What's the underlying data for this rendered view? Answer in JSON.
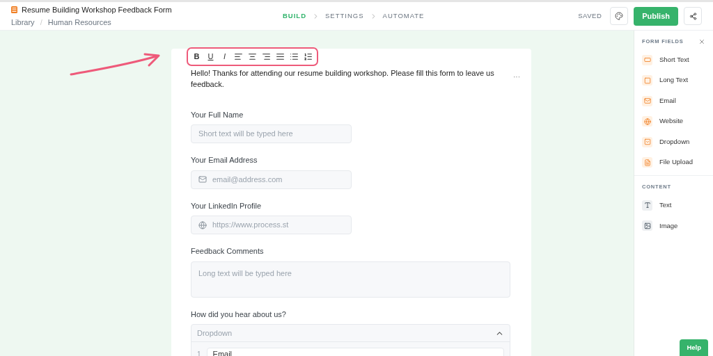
{
  "header": {
    "title": "Resume Building Workshop Feedback Form",
    "breadcrumb": [
      "Library",
      "Human Resources"
    ],
    "separator": "/",
    "steps": [
      {
        "label": "BUILD",
        "selected": true
      },
      {
        "label": "SETTINGS",
        "selected": false
      },
      {
        "label": "AUTOMATE",
        "selected": false
      }
    ],
    "status": "SAVED",
    "publish": "Publish"
  },
  "editor": {
    "toolbar": [
      {
        "kind": "bold",
        "label": "B"
      },
      {
        "kind": "underline",
        "label": "U"
      },
      {
        "kind": "italic",
        "label": "I"
      },
      {
        "kind": "align-left"
      },
      {
        "kind": "align-center"
      },
      {
        "kind": "align-right"
      },
      {
        "kind": "justify"
      },
      {
        "kind": "bullets"
      },
      {
        "kind": "numbers"
      }
    ],
    "intro": "Hello! Thanks for attending our resume building workshop. Please fill this form to leave us feedback.",
    "more": "···"
  },
  "fields": [
    {
      "kind": "short",
      "label": "Your Full Name",
      "placeholder": "Short text will be typed here"
    },
    {
      "kind": "email",
      "label": "Your Email Address",
      "placeholder": "email@address.com"
    },
    {
      "kind": "website",
      "label": "Your LinkedIn Profile",
      "placeholder": "https://www.process.st"
    },
    {
      "kind": "long",
      "label": "Feedback Comments",
      "placeholder": "Long text will be typed here"
    },
    {
      "kind": "dropdown",
      "label": "How did you hear about us?",
      "placeholder": "Dropdown",
      "expanded": true,
      "options": [
        {
          "number": "1",
          "value": "Email"
        }
      ]
    }
  ],
  "sidebar": {
    "sections": [
      {
        "title": "FORM FIELDS",
        "items": [
          {
            "kind": "short",
            "label": "Short Text"
          },
          {
            "kind": "long",
            "label": "Long Text"
          },
          {
            "kind": "email",
            "label": "Email"
          },
          {
            "kind": "website",
            "label": "Website"
          },
          {
            "kind": "dropdown",
            "label": "Dropdown"
          },
          {
            "kind": "upload",
            "label": "File Upload"
          }
        ]
      },
      {
        "title": "CONTENT",
        "items": [
          {
            "kind": "text",
            "label": "Text"
          },
          {
            "kind": "image",
            "label": "Image"
          }
        ]
      }
    ]
  },
  "help": "Help"
}
